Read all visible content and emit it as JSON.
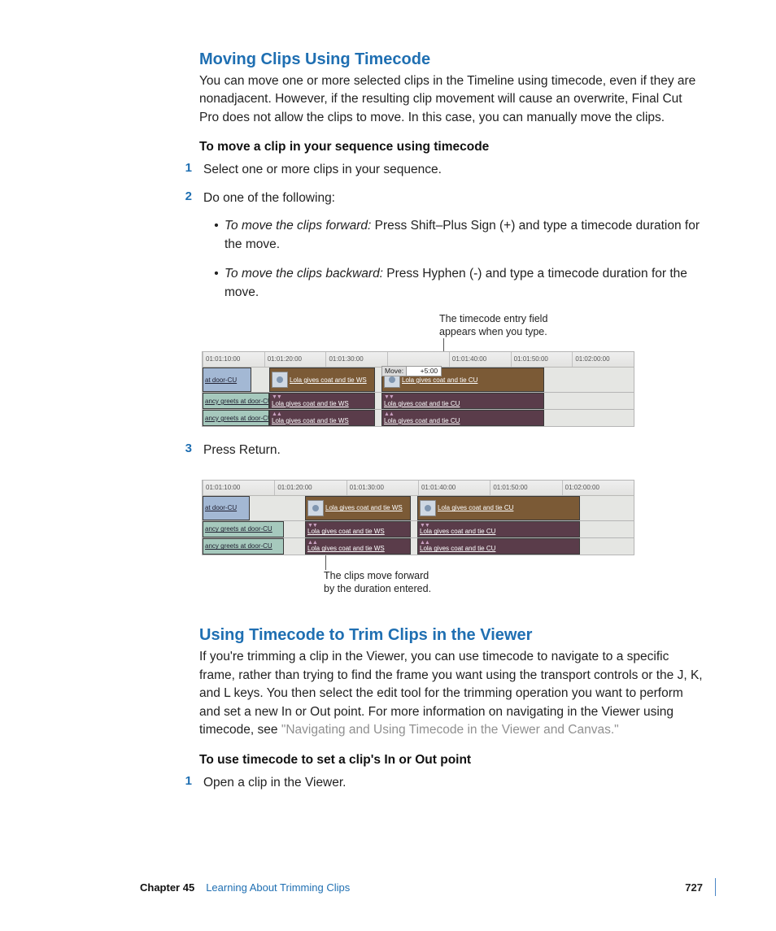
{
  "section1": {
    "heading": "Moving Clips Using Timecode",
    "para": "You can move one or more selected clips in the Timeline using timecode, even if they are nonadjacent. However, if the resulting clip movement will cause an overwrite, Final Cut Pro does not allow the clips to move. In this case, you can manually move the clips.",
    "sub": "To move a clip in your sequence using timecode",
    "step1_num": "1",
    "step1": "Select one or more clips in your sequence.",
    "step2_num": "2",
    "step2": "Do one of the following:",
    "bullet1_em": "To move the clips forward:",
    "bullet1": "  Press Shift–Plus Sign (+) and type a timecode duration for the move.",
    "bullet2_em": "To move the clips backward:",
    "bullet2": "  Press Hyphen (-) and type a timecode duration for the move.",
    "callout_top1": "The timecode entry field",
    "callout_top2": "appears when you type.",
    "step3_num": "3",
    "step3": "Press Return.",
    "callout_bottom1": "The clips move forward",
    "callout_bottom2": "by the duration entered."
  },
  "timeline1": {
    "ruler": [
      "01:01:10:00",
      "01:01:20:00",
      "01:01:30:00",
      "",
      "01:01:40:00",
      "01:01:50:00",
      "01:02:00:00"
    ],
    "move_label": "Move:",
    "move_value": "+5:00",
    "v1_a": "at door-CU",
    "v1_b": "Lola gives coat and tie WS",
    "v1_c": "Lola gives coat and tie CU",
    "a1_a": "ancy greets at door-CU",
    "a1_b": "Lola gives coat and tie WS",
    "a1_c": "Lola gives coat and tie CU",
    "a2_a": "ancy greets at door-CU",
    "a2_b": "Lola gives coat and tie WS",
    "a2_c": "Lola gives coat and tie CU"
  },
  "timeline2": {
    "ruler": [
      "01:01:10:00",
      "01:01:20:00",
      "01:01:30:00",
      "01:01:40:00",
      "01:01:50:00",
      "01:02:00:00"
    ],
    "v1_a": "at door-CU",
    "v1_b": "Lola gives coat and tie WS",
    "v1_c": "Lola gives coat and tie CU",
    "a1_a": "ancy greets at door-CU",
    "a1_b": "Lola gives coat and tie WS",
    "a1_c": "Lola gives coat and tie CU",
    "a2_a": "ancy greets at door-CU",
    "a2_b": "Lola gives coat and tie WS",
    "a2_c": "Lola gives coat and tie CU"
  },
  "section2": {
    "heading": "Using Timecode to Trim Clips in the Viewer",
    "para_a": "If you're trimming a clip in the Viewer, you can use timecode to navigate to a specific frame, rather than trying to find the frame you want using the transport controls or the J, K, and L keys. You then select the edit tool for the trimming operation you want to perform and set a new In or Out point. For more information on navigating in the Viewer using timecode, see ",
    "xref": "\"Navigating and Using Timecode in the Viewer and Canvas.\"",
    "sub": "To use timecode to set a clip's In or Out point",
    "step1_num": "1",
    "step1": "Open a clip in the Viewer."
  },
  "footer": {
    "chapter": "Chapter 45",
    "title": "Learning About Trimming Clips",
    "page": "727"
  }
}
